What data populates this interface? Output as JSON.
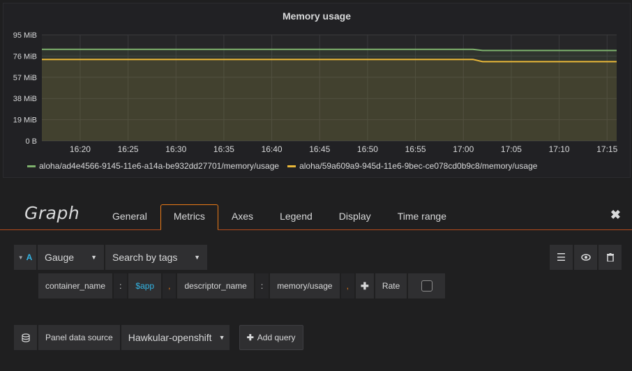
{
  "panel": {
    "title": "Memory usage"
  },
  "chart_data": {
    "type": "area",
    "title": "Memory usage",
    "y_ticks": [
      "95 MiB",
      "76 MiB",
      "57 MiB",
      "38 MiB",
      "19 MiB",
      "0 B"
    ],
    "x_ticks": [
      "16:20",
      "16:25",
      "16:30",
      "16:35",
      "16:40",
      "16:45",
      "16:50",
      "16:55",
      "17:00",
      "17:05",
      "17:10",
      "17:15"
    ],
    "ylim": [
      0,
      95
    ],
    "xlim": [
      "16:16",
      "17:16"
    ],
    "grid": true,
    "legend_placement": "bottom-left",
    "series": [
      {
        "name": "aloha/ad4e4566-9145-11e6-a14a-be932dd27701/memory/usage",
        "color": "#7eb26d",
        "x": [
          "16:16",
          "17:01",
          "17:02",
          "17:16"
        ],
        "values": [
          82,
          82,
          81,
          81
        ]
      },
      {
        "name": "aloha/59a609a9-945d-11e6-9bec-ce078cd0b9c8/memory/usage",
        "color": "#eab839",
        "x": [
          "16:16",
          "16:57",
          "17:01",
          "17:02",
          "17:16"
        ],
        "values": [
          73,
          73,
          73,
          71,
          71
        ]
      }
    ]
  },
  "editor": {
    "title": "Graph",
    "tabs": [
      "General",
      "Metrics",
      "Axes",
      "Legend",
      "Display",
      "Time range"
    ],
    "active_tab": "Metrics",
    "close_icon": "times-icon"
  },
  "query": {
    "ref_id": "A",
    "type": "Gauge",
    "search": "Search by tags",
    "tags": {
      "key1": "container_name",
      "sep1": ":",
      "val1": "$app",
      "comma1": ",",
      "key2": "descriptor_name",
      "sep2": ":",
      "val2": "memory/usage",
      "comma2": ","
    },
    "rate_label": "Rate",
    "rate_checked": false
  },
  "footer": {
    "datasource_label": "Panel data source",
    "datasource_value": "Hawkular-openshift",
    "add_query_label": "Add query"
  },
  "colors": {
    "accent": "#eb7b18",
    "ref_blue": "#33b5e5",
    "series1": "#7eb26d",
    "series2": "#eab839"
  }
}
